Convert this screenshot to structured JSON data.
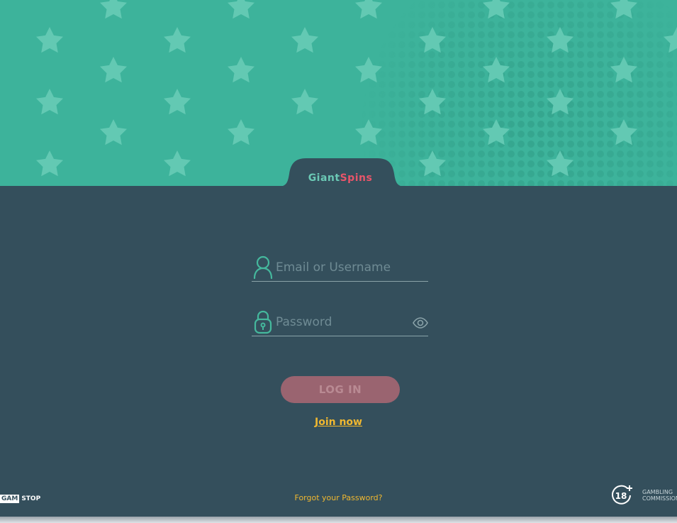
{
  "brand": {
    "logo_part1": "Giant",
    "logo_part2": "Spins"
  },
  "login_form": {
    "email_placeholder": "Email or Username",
    "password_placeholder": "Password",
    "login_label": "LOG IN",
    "join_label": "Join now",
    "forgot_label": "Forgot your Password?"
  },
  "footer": {
    "gamstop_part1": "GAM",
    "gamstop_part2": "STOP",
    "age_badge": "18",
    "commission_line1": "GAMBLING",
    "commission_line2": "COMMISSION"
  },
  "colors": {
    "hero": "#3db39b",
    "panel": "#344f5c",
    "accent": "#f0b830",
    "button": "#9a6470"
  }
}
